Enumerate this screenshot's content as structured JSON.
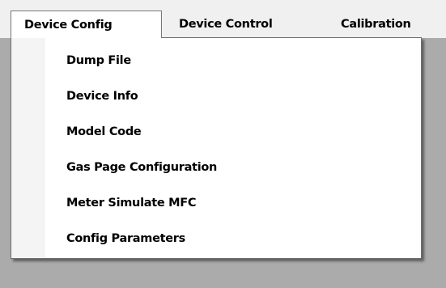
{
  "menubar": {
    "items": [
      {
        "label": "Device Config",
        "active": true
      },
      {
        "label": "Device Control",
        "active": false
      },
      {
        "label": "Calibration",
        "active": false
      }
    ]
  },
  "dropdown": {
    "items": [
      {
        "label": "Dump File"
      },
      {
        "label": "Device Info"
      },
      {
        "label": "Model Code"
      },
      {
        "label": "Gas Page Configuration"
      },
      {
        "label": "Meter Simulate MFC"
      },
      {
        "label": "Config Parameters"
      }
    ]
  },
  "colors": {
    "menubar_bg": "#f0f0f0",
    "dropdown_bg": "#ffffff",
    "window_bg": "#ababab",
    "border": "#777777"
  }
}
